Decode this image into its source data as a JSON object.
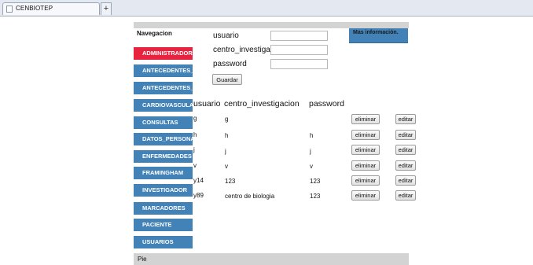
{
  "browser": {
    "tab_title": "CENBIOTEP",
    "new_tab_symbol": "+"
  },
  "nav": {
    "title": "Navegacion",
    "items": [
      {
        "label": "ADMINISTRADOR",
        "active": true
      },
      {
        "label": "ANTECEDENTES_FAMILIARES",
        "active": false
      },
      {
        "label": "ANTECEDENTES_PERSONALES",
        "active": false
      },
      {
        "label": "CARDIOVASCULAR",
        "active": false
      },
      {
        "label": "CONSULTAS",
        "active": false
      },
      {
        "label": "DATOS_PERSONALES",
        "active": false
      },
      {
        "label": "ENFERMEDADES",
        "active": false
      },
      {
        "label": "FRAMINGHAM",
        "active": false
      },
      {
        "label": "INVESTIGADOR",
        "active": false
      },
      {
        "label": "MARCADORES",
        "active": false
      },
      {
        "label": "PACIENTE",
        "active": false
      },
      {
        "label": "USUARIOS",
        "active": false
      }
    ]
  },
  "info": {
    "title": "Mas información."
  },
  "form": {
    "usuario_label": "usuario",
    "usuario_value": "",
    "centro_label": "centro_investigacion",
    "centro_value": "",
    "password_label": "password",
    "password_value": "",
    "save_label": "Guardar"
  },
  "table": {
    "headers": [
      "usuario",
      "centro_investigacion",
      "password"
    ],
    "rows": [
      [
        "g",
        "g",
        ""
      ],
      [
        "h",
        "h",
        "h"
      ],
      [
        "j",
        "j",
        "j"
      ],
      [
        "v",
        "v",
        "v"
      ],
      [
        "y14",
        "123",
        "123"
      ],
      [
        "y89",
        "centro de biologia",
        "123"
      ]
    ],
    "delete_label": "eliminar",
    "edit_label": "editar"
  },
  "footer": {
    "text": "Pie"
  },
  "colors": {
    "nav_blue": "#4382b7",
    "nav_active": "#e8233f",
    "frame_gray": "#d3d3d3"
  }
}
